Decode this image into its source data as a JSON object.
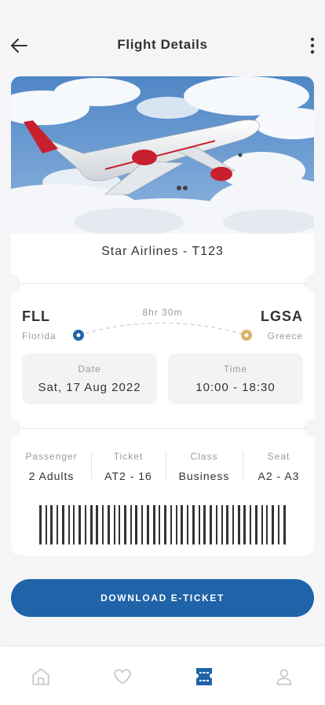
{
  "header": {
    "title": "Flight Details"
  },
  "flight": {
    "airline": "Star Airlines - T123",
    "origin": {
      "code": "FLL",
      "city": "Florida"
    },
    "destination": {
      "code": "LGSA",
      "city": "Greece"
    },
    "duration": "8hr 30m"
  },
  "schedule": {
    "date_label": "Date",
    "date_value": "Sat, 17 Aug 2022",
    "time_label": "Time",
    "time_value": "10:00 - 18:30"
  },
  "details": [
    {
      "label": "Passenger",
      "value": "2 Adults"
    },
    {
      "label": "Ticket",
      "value": "AT2 - 16"
    },
    {
      "label": "Class",
      "value": "Business"
    },
    {
      "label": "Seat",
      "value": "A2 - A3"
    }
  ],
  "actions": {
    "download_label": "DOWNLOAD E-TICKET"
  },
  "colors": {
    "accent": "#1f63a8",
    "destination_dot": "#d9b36a",
    "text": "#333333",
    "muted": "#9a9a9a"
  },
  "nav": {
    "items": [
      {
        "icon": "home-icon",
        "active": false
      },
      {
        "icon": "heart-icon",
        "active": false
      },
      {
        "icon": "ticket-icon",
        "active": true
      },
      {
        "icon": "user-icon",
        "active": false
      }
    ]
  }
}
